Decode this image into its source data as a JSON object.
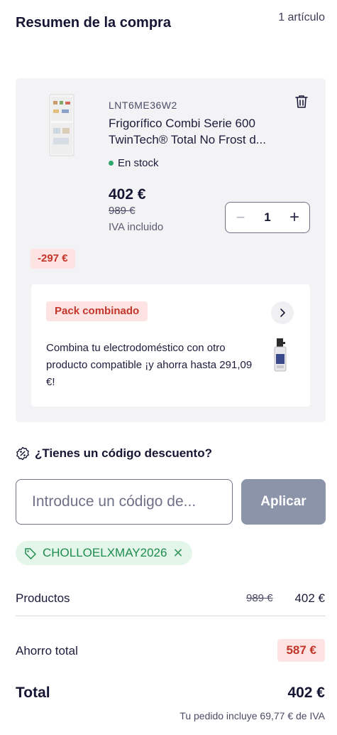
{
  "header": {
    "title": "Resumen de la compra",
    "item_count": "1 artículo"
  },
  "product": {
    "sku": "LNT6ME36W2",
    "name": "Frigorífico Combi Serie 600 TwinTech® Total No Frost d...",
    "stock": "En stock",
    "price": "402 €",
    "old_price": "989 €",
    "vat_note": "IVA incluido",
    "quantity": "1",
    "discount": "-297 €",
    "image_icon": "fridge-image",
    "delete_icon": "trash-icon"
  },
  "pack": {
    "badge": "Pack combinado",
    "text": "Combina tu electrodoméstico con otro producto compatible ¡y ahorra hasta 291,09 €!",
    "image_icon": "cleaner-spray-image"
  },
  "coupon": {
    "question": "¿Tienes un código descuento?",
    "placeholder": "Introduce un código de...",
    "apply_label": "Aplicar",
    "applied_code": "CHOLLOELXMAY2026"
  },
  "summary": {
    "products_label": "Productos",
    "products_old": "989 €",
    "products_new": "402 €",
    "savings_label": "Ahorro total",
    "savings_value": "587 €",
    "total_label": "Total",
    "total_value": "402 €",
    "vat_info": "Tu pedido incluye 69,77 € de IVA"
  },
  "colors": {
    "accent_red": "#c2352b",
    "badge_bg": "#fde3e1",
    "stock_green": "#2ea86b",
    "apply_button": "#8c94aa",
    "chip_bg": "#e4f6ea"
  }
}
